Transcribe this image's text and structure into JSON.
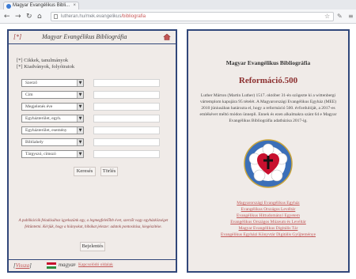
{
  "browser": {
    "tab_title": "Magyar Evangélikus Bibli...",
    "tab_close": "×",
    "url_host": "lutheran.hu/mek.evangelikus",
    "url_path": "/bibliografia",
    "back_icon": "arrow-left-icon",
    "forward_icon": "arrow-right-icon",
    "reload_icon": "reload-icon",
    "home_icon": "home-icon",
    "star_icon": "star-icon",
    "extension_icon": "puzzle-icon",
    "menu_icon": "menu-icon"
  },
  "left_panel": {
    "home_mark": "[*]",
    "title": "Magyar Evangélikus Bibliográfia",
    "filters": [
      "[*] Cikkek, tanulmányok",
      "[*] Kiadványok, folyóiratok"
    ],
    "fields": [
      "Szerző",
      "Cím",
      "Megjelenés éve",
      "Egyházterület, egyh.",
      "Egyházterület, esemény",
      "Bibliahely",
      "Tárgyszó, címszó"
    ],
    "search_button": "Keresés",
    "clear_button": "Törlés",
    "hint": "A publikációk feladásához igyekszünk egy, a legmegfelelőbb évet, szerzőt vagy egyházközséget feltüntetni. Kérjük, hogy a hiányokat, hibákat jelezze: adatok pontosítása, kiegészítése.",
    "submit_button": "Bejelentés",
    "related_link": "Kapcsolódó oldalak",
    "footer_open": "[",
    "footer_link": "Vissza",
    "footer_close": "]",
    "footer_lang": "magyar"
  },
  "right_panel": {
    "title": "Magyar Evangélikus Bibliográfia",
    "heading": "Reformáció.500",
    "description": "Luther Márton (Martin Luther) 1517. október 31-én szögezte ki a wittenbergi vártemplom kapujára 95 tételét. A Magyarországi Evangélikus Egyház (MEE) 2010 júniusában határozta el, hogy a reformáció 500. évfordulóját, a 2017-es emlékévet méltó módon ünnepli. Ennek és ezen alkalmakra szánt 64 e Magyar Evangélikus Bibliográfia adatbázisa 2017-ig.",
    "links": [
      "Magyarországi Evangélikus Egyház",
      "Evangélikus Országos Levéltár",
      "Evangélikus Hittudományi Egyetem",
      "Evangélikus Országos Múzeum és Levéltár",
      "Magyar Evangélikus Digitális Tár",
      "Evangélikus Egyházi Könyvtár Digitális Gyűjteménye"
    ]
  },
  "colors": {
    "panel_bg": "#f0ebe8",
    "panel_border": "#31477a",
    "accent_red": "#8c2f2f",
    "link_red": "#c25555"
  }
}
